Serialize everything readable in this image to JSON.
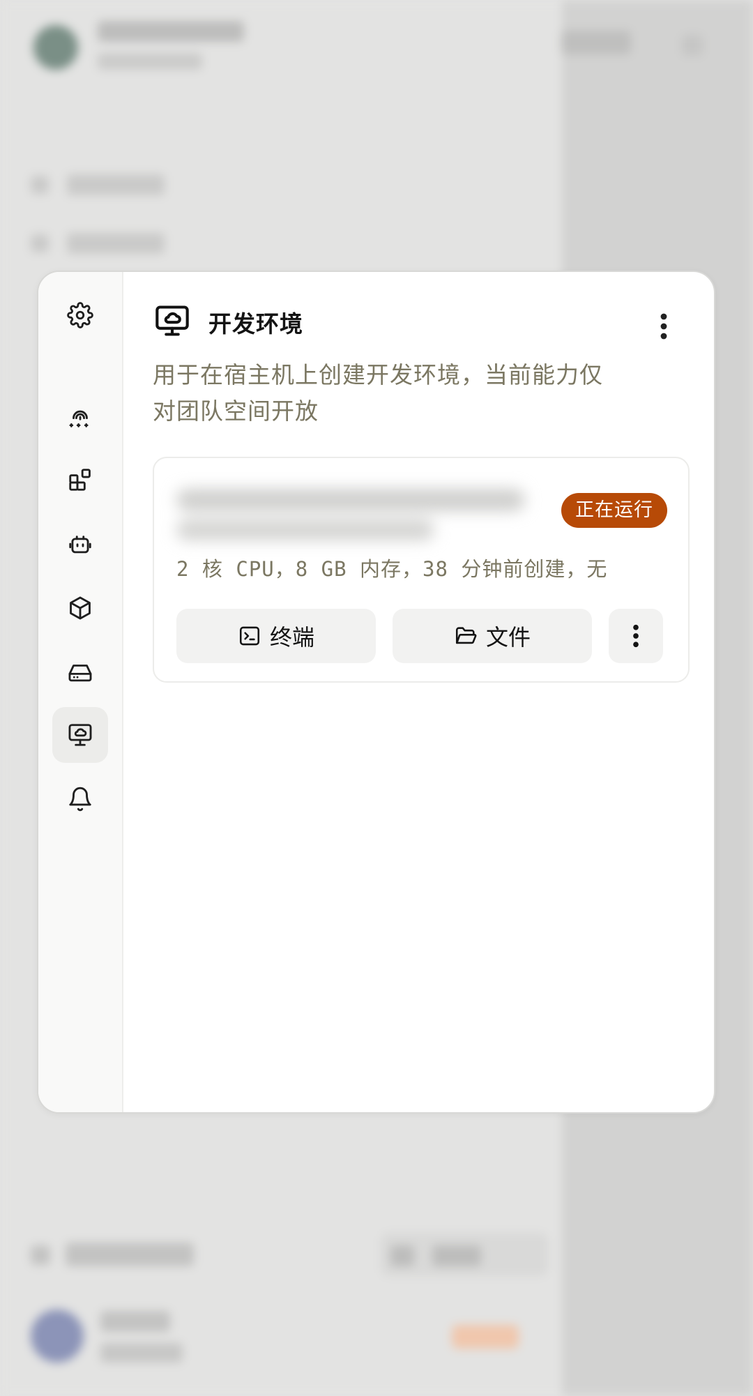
{
  "sidebar": {
    "items": [
      {
        "icon": "gear-icon",
        "active": false
      },
      {
        "icon": "fingerprint-password-icon",
        "active": false
      },
      {
        "icon": "apps-icon",
        "active": false
      },
      {
        "icon": "robot-icon",
        "active": false
      },
      {
        "icon": "cube-icon",
        "active": false
      },
      {
        "icon": "hard-drive-icon",
        "active": false
      },
      {
        "icon": "monitor-cloud-icon",
        "active": true
      },
      {
        "icon": "bell-icon",
        "active": false
      }
    ]
  },
  "header": {
    "icon": "monitor-cloud-icon",
    "title": "开发环境",
    "description": "用于在宿主机上创建开发环境，当前能力仅对团队空间开放"
  },
  "environment_card": {
    "status": "正在运行",
    "status_color": "#b74a07",
    "spec": "2 核 CPU，8 GB 内存，38 分钟前创建，无",
    "terminal_label": "终端",
    "files_label": "文件"
  }
}
